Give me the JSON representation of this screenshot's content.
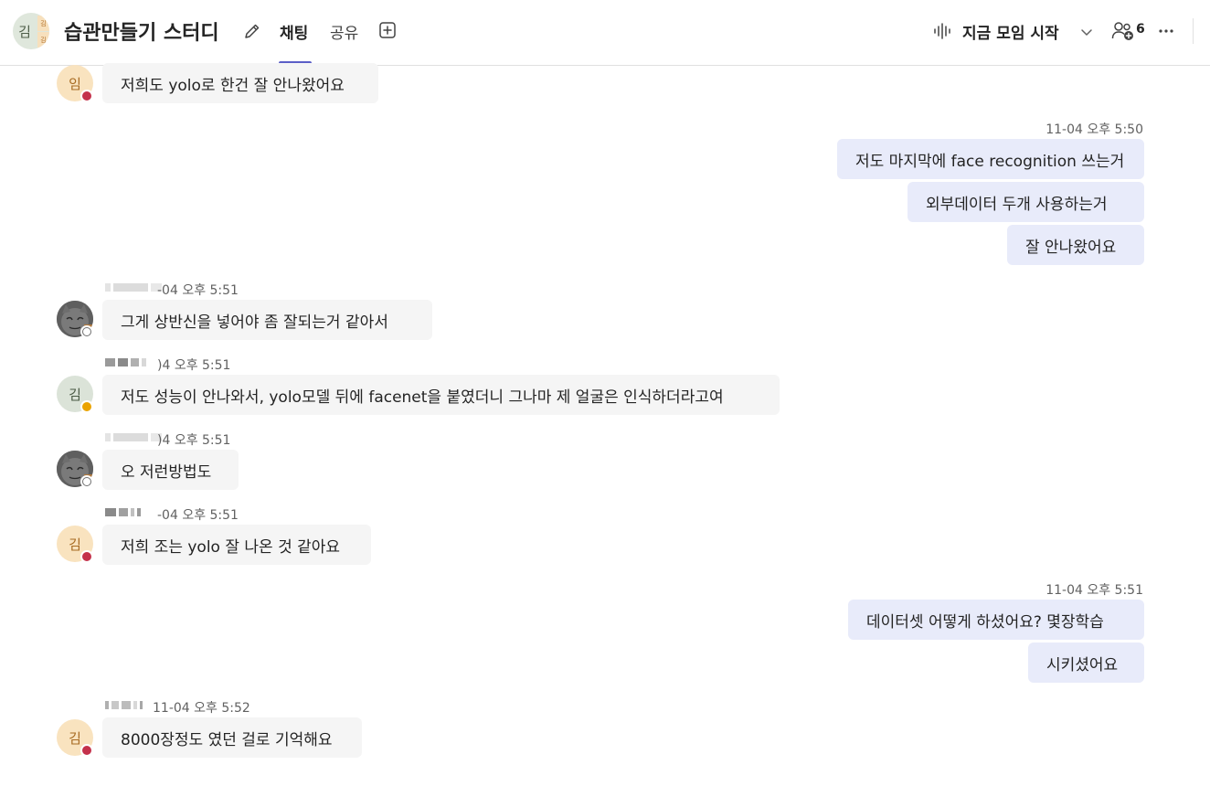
{
  "header": {
    "group_avatar": {
      "main": "김",
      "small_top": "김",
      "small_bottom": "김"
    },
    "title": "습관만들기 스터디",
    "tabs": [
      {
        "label": "채팅",
        "active": true
      },
      {
        "label": "공유",
        "active": false
      }
    ],
    "meet_label": "지금 모임 시작",
    "participant_count": "6",
    "icons": {
      "edit": "pencil-icon",
      "add_tab": "plus-square-icon",
      "meet": "audio-wave-icon",
      "participants": "people-add-icon",
      "more": "more-horizontal-icon"
    },
    "accent_color": "#5b5fc7"
  },
  "messages": [
    {
      "direction": "in",
      "avatar": "임",
      "status": "busy",
      "text": "저희도 yolo로 한건 잘 안나왔어요"
    },
    {
      "direction": "out",
      "time": "11-04 오후 5:50",
      "lines": [
        "저도 마지막에 face recognition 쓰는거",
        "외부데이터 두개 사용하는거",
        "잘 안나왔어요"
      ]
    },
    {
      "direction": "in",
      "avatar": "cat",
      "status": "offline",
      "time": "11-04 오후 5:51",
      "time_visible": "-04 오후 5:51",
      "text": "그게 상반신을 넣어야 좀 잘되는거 같아서"
    },
    {
      "direction": "in",
      "avatar": "김",
      "status": "away",
      "time": "11-04 오후 5:51",
      "time_visible": ")4 오후 5:51",
      "text": "저도 성능이 안나와서, yolo모델 뒤에 facenet을 붙였더니 그나마 제 얼굴은 인식하더라고여"
    },
    {
      "direction": "in",
      "avatar": "cat",
      "status": "offline",
      "time": "11-04 오후 5:51",
      "time_visible": ")4 오후 5:51",
      "text": "오 저런방법도"
    },
    {
      "direction": "in",
      "avatar": "김",
      "status": "busy",
      "time": "11-04 오후 5:51",
      "time_visible": "-04 오후 5:51",
      "text": "저희 조는 yolo 잘 나온 것 같아요"
    },
    {
      "direction": "out",
      "time": "11-04 오후 5:51",
      "lines": [
        "데이터셋 어떻게 하셨어요? 몇장학습",
        "시키셨어요"
      ]
    },
    {
      "direction": "in",
      "avatar": "김",
      "status": "busy",
      "time": "11-04 오후 5:52",
      "time_visible": "11-04 오후 5:52",
      "text": "8000장정도 였던 걸로 기억해요"
    }
  ],
  "colors": {
    "incoming_bubble": "#f5f5f5",
    "outgoing_bubble": "#e8ebfa",
    "busy": "#c4314b",
    "away": "#eaa300"
  }
}
